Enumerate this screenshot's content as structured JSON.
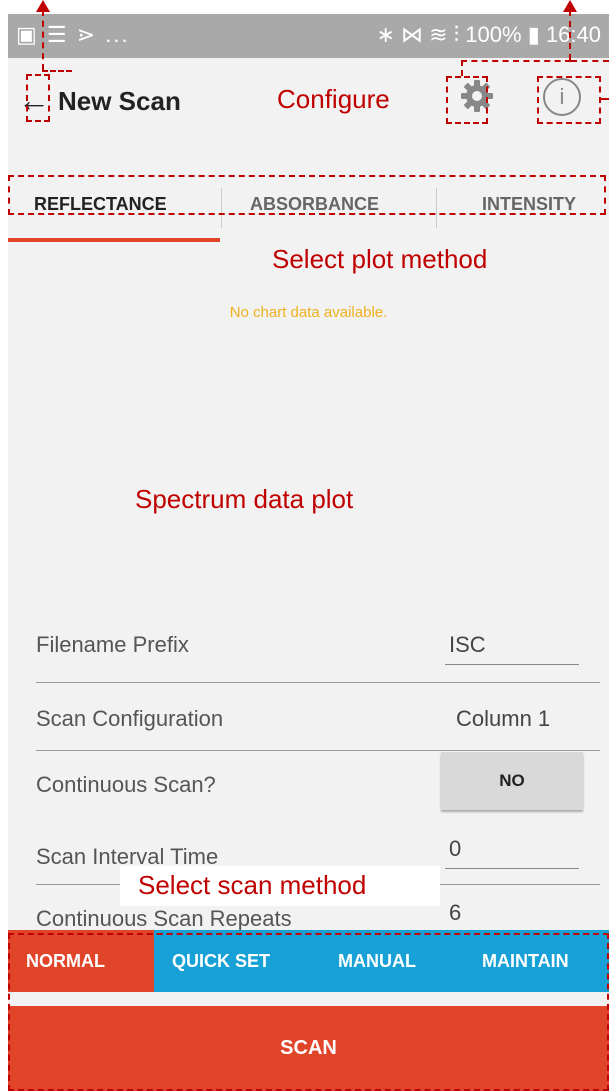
{
  "status_bar": {
    "left_icons": "▣ ☰ ⋗ ...",
    "right_icons": "∗ ⋈ ≋ ⫶",
    "battery": "100%",
    "battery_icon": "battery-charging",
    "time": "16:40"
  },
  "header": {
    "back_icon": "back-arrow-icon",
    "title": "New Scan",
    "settings_icon": "gear-icon",
    "info_icon": "info-icon"
  },
  "tabs": [
    "REFLECTANCE",
    "ABSORBANCE",
    "INTENSITY"
  ],
  "chart": {
    "empty_message": "No chart data available."
  },
  "fields": {
    "filename_prefix": {
      "label": "Filename Prefix",
      "value": "ISC"
    },
    "scan_configuration": {
      "label": "Scan Configuration",
      "value": "Column 1"
    },
    "continuous_scan": {
      "label": "Continuous Scan?",
      "value": "NO"
    },
    "scan_interval_time": {
      "label": "Scan Interval Time",
      "value": "0"
    },
    "continuous_scan_repeats": {
      "label": "Continuous Scan Repeats",
      "value": "6"
    }
  },
  "scan_modes": [
    "NORMAL",
    "QUICK SET",
    "MANUAL",
    "MAINTAIN"
  ],
  "scan_button": "SCAN",
  "annotations": {
    "configure": "Configure",
    "plot_method": "Select plot method",
    "spectrum": "Spectrum data plot",
    "scan_method": "Select scan method"
  },
  "colors": {
    "accent_red": "#e0452a",
    "mode_blue": "#17a1d6",
    "annotation_red": "#c00000",
    "no_data_yellow": "#f0b020"
  }
}
